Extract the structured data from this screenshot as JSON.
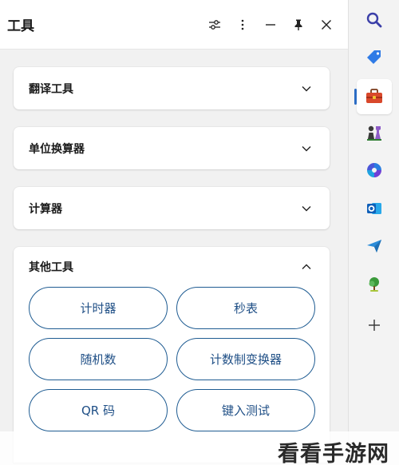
{
  "header": {
    "title": "工具"
  },
  "sections": [
    {
      "title": "翻译工具",
      "expanded": false
    },
    {
      "title": "单位换算器",
      "expanded": false
    },
    {
      "title": "计算器",
      "expanded": false
    },
    {
      "title": "其他工具",
      "expanded": true,
      "buttons": [
        "计时器",
        "秒表",
        "随机数",
        "计数制变换器",
        "QR 码",
        "键入测试"
      ]
    }
  ],
  "sidebar": {
    "icons": [
      "search-icon",
      "tag-icon",
      "toolbox-icon",
      "chess-icon",
      "copilot-icon",
      "outlook-icon",
      "send-icon",
      "tree-icon",
      "plus-icon"
    ],
    "active": "toolbox-icon"
  },
  "colors": {
    "accent": "#1f5c92",
    "active_bar": "#2b6cc4"
  },
  "watermark": "看看手游网"
}
